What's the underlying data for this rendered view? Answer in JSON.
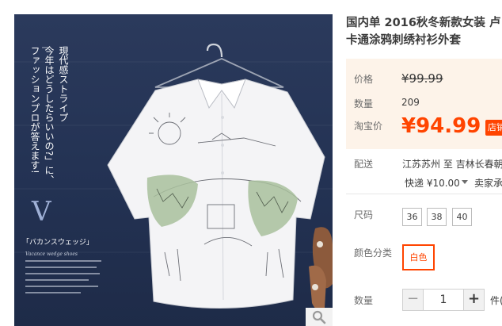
{
  "product": {
    "title_line1": "国内单 2016秋冬新款女装 卢",
    "title_line2": "卡通涂鸦刺绣衬衫外套"
  },
  "price": {
    "price_label": "价格",
    "original_price": "¥99.99",
    "quantity_label": "数量",
    "quantity_sold": "209",
    "taobao_price_label": "淘宝价",
    "taobao_price": "¥94.99",
    "shop_badge": "店铺"
  },
  "shipping": {
    "label": "配送",
    "route": "江苏苏州 至  吉林长春朝",
    "fee": "快递 ¥10.00",
    "seller_note": "卖家承"
  },
  "options": {
    "size_label": "尺码",
    "sizes": [
      "36",
      "38",
      "40"
    ],
    "color_label": "颜色分类",
    "colors": [
      "白色"
    ]
  },
  "purchase": {
    "quantity_label": "数量",
    "minus": "−",
    "quantity_value": "1",
    "plus": "+",
    "unit_note": "件(库"
  },
  "image": {
    "magazine_jp_lines": [
      "現代感ストライプ",
      "今年はどうしたらいいの?」に、",
      "ファッションプロが答えます!"
    ],
    "magazine_big_letter": "V",
    "magazine_caption": "「バカンスウェッジ」",
    "magazine_small": "Vacance wedge shoes"
  },
  "colors": {
    "accent": "#ff4400",
    "price_bg": "#fdf3e9",
    "image_bg": "#233253"
  },
  "icons": {
    "zoom": "magnifier-icon",
    "dropdown": "caret-down-icon"
  }
}
